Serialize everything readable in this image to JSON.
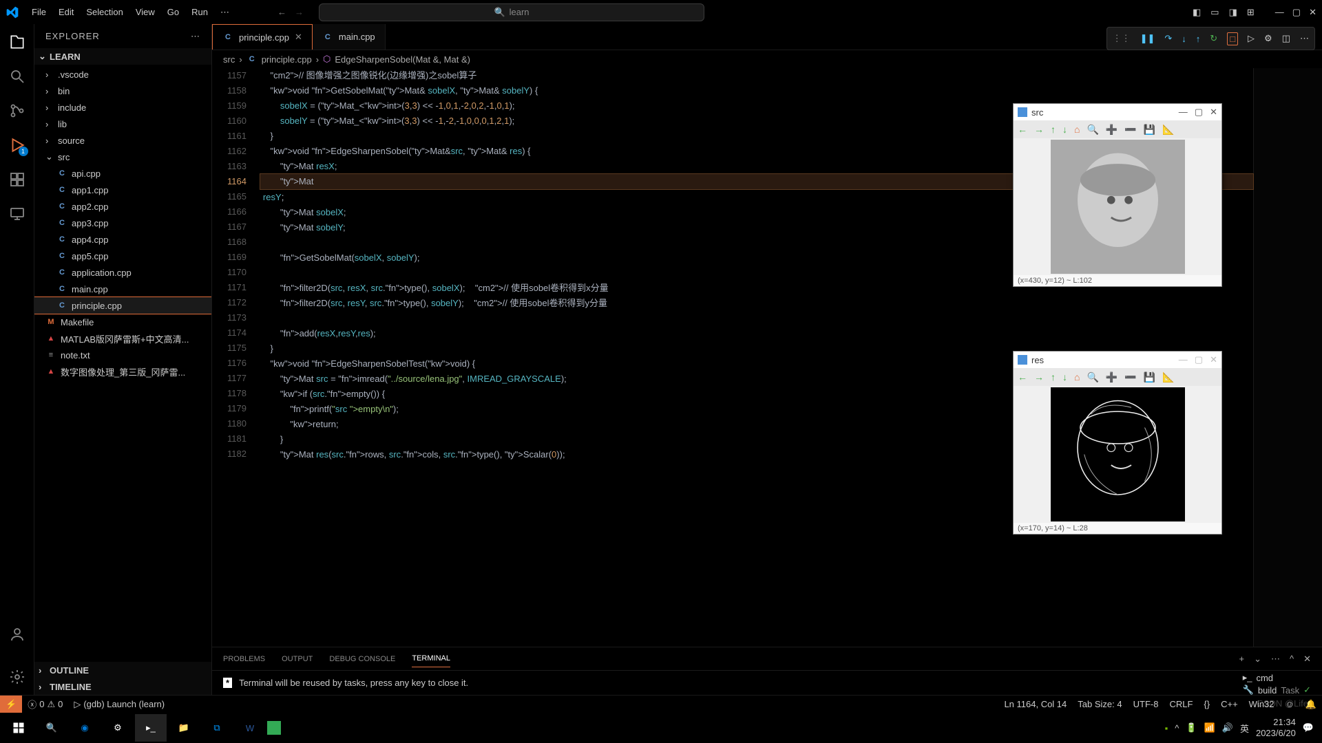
{
  "menu": {
    "file": "File",
    "edit": "Edit",
    "selection": "Selection",
    "view": "View",
    "go": "Go",
    "run": "Run"
  },
  "search": {
    "placeholder": "learn"
  },
  "explorer": {
    "title": "EXPLORER",
    "project": "LEARN",
    "folders": [
      ".vscode",
      "bin",
      "include",
      "lib",
      "source",
      "src"
    ],
    "srcFiles": [
      "api.cpp",
      "app1.cpp",
      "app2.cpp",
      "app3.cpp",
      "app4.cpp",
      "app5.cpp",
      "application.cpp",
      "main.cpp",
      "principle.cpp"
    ],
    "rootFiles": [
      {
        "name": "Makefile",
        "type": "mk"
      },
      {
        "name": "MATLAB版冈萨雷斯+中文高清...",
        "type": "pdf"
      },
      {
        "name": "note.txt",
        "type": "txt"
      },
      {
        "name": "数字图像处理_第三版_冈萨雷...",
        "type": "pdf"
      }
    ],
    "outline": "OUTLINE",
    "timeline": "TIMELINE"
  },
  "tabs": [
    {
      "name": "principle.cpp",
      "active": true
    },
    {
      "name": "main.cpp",
      "active": false
    }
  ],
  "breadcrumb": {
    "a": "src",
    "b": "principle.cpp",
    "c": "EdgeSharpenSobel(Mat &, Mat &)"
  },
  "code": {
    "startLine": 1157,
    "highlightLine": 1164,
    "lines": [
      "    // 图像增强之图像锐化(边缘增强)之sobel算子",
      "    void GetSobelMat(Mat& sobelX, Mat& sobelY) {",
      "        sobelX = (Mat_<int>(3,3) << -1,0,1,-2,0,2,-1,0,1);",
      "        sobelY = (Mat_<int>(3,3) << -1,-2,-1,0,0,0,1,2,1);",
      "    }",
      "    void EdgeSharpenSobel(Mat&src, Mat& res) {",
      "        Mat resX;",
      "        Mat resY;",
      "        Mat sobelX;",
      "        Mat sobelY;",
      "",
      "        GetSobelMat(sobelX, sobelY);",
      "",
      "        filter2D(src, resX, src.type(), sobelX);    // 使用sobel卷积得到x分量",
      "        filter2D(src, resY, src.type(), sobelY);    // 使用sobel卷积得到y分量",
      "",
      "        add(resX,resY,res);",
      "    }",
      "    void EdgeSharpenSobelTest(void) {",
      "        Mat src = imread(\"../source/lena.jpg\", IMREAD_GRAYSCALE);",
      "        if (src.empty()) {",
      "            printf(\"src empty\\n\");",
      "            return;",
      "        }",
      "        Mat res(src.rows, src.cols, src.type(), Scalar(0));",
      ""
    ]
  },
  "termTabs": {
    "problems": "PROBLEMS",
    "output": "OUTPUT",
    "debug": "DEBUG CONSOLE",
    "terminal": "TERMINAL"
  },
  "terminal": {
    "msg": "Terminal will be reused by tasks, press any key to close it.",
    "badge": "*",
    "shells": [
      {
        "name": "cmd"
      },
      {
        "name": "build",
        "sub": "Task"
      }
    ]
  },
  "status": {
    "errors": "0",
    "warnings": "0",
    "launch": "(gdb) Launch (learn)",
    "ln": "Ln 1164, Col 14",
    "tab": "Tab Size: 4",
    "enc": "UTF-8",
    "eol": "CRLF",
    "brackets": "{}",
    "lang": "C++",
    "os": "Win32"
  },
  "floatWindows": [
    {
      "title": "src",
      "status": "(x=430, y=12) ~ L:102"
    },
    {
      "title": "res",
      "status": "(x=170, y=14) ~ L:28"
    }
  ],
  "taskbar": {
    "time": "21:34",
    "date": "2023/6/20",
    "ime": "英"
  },
  "watermark": "CSDN @Life"
}
